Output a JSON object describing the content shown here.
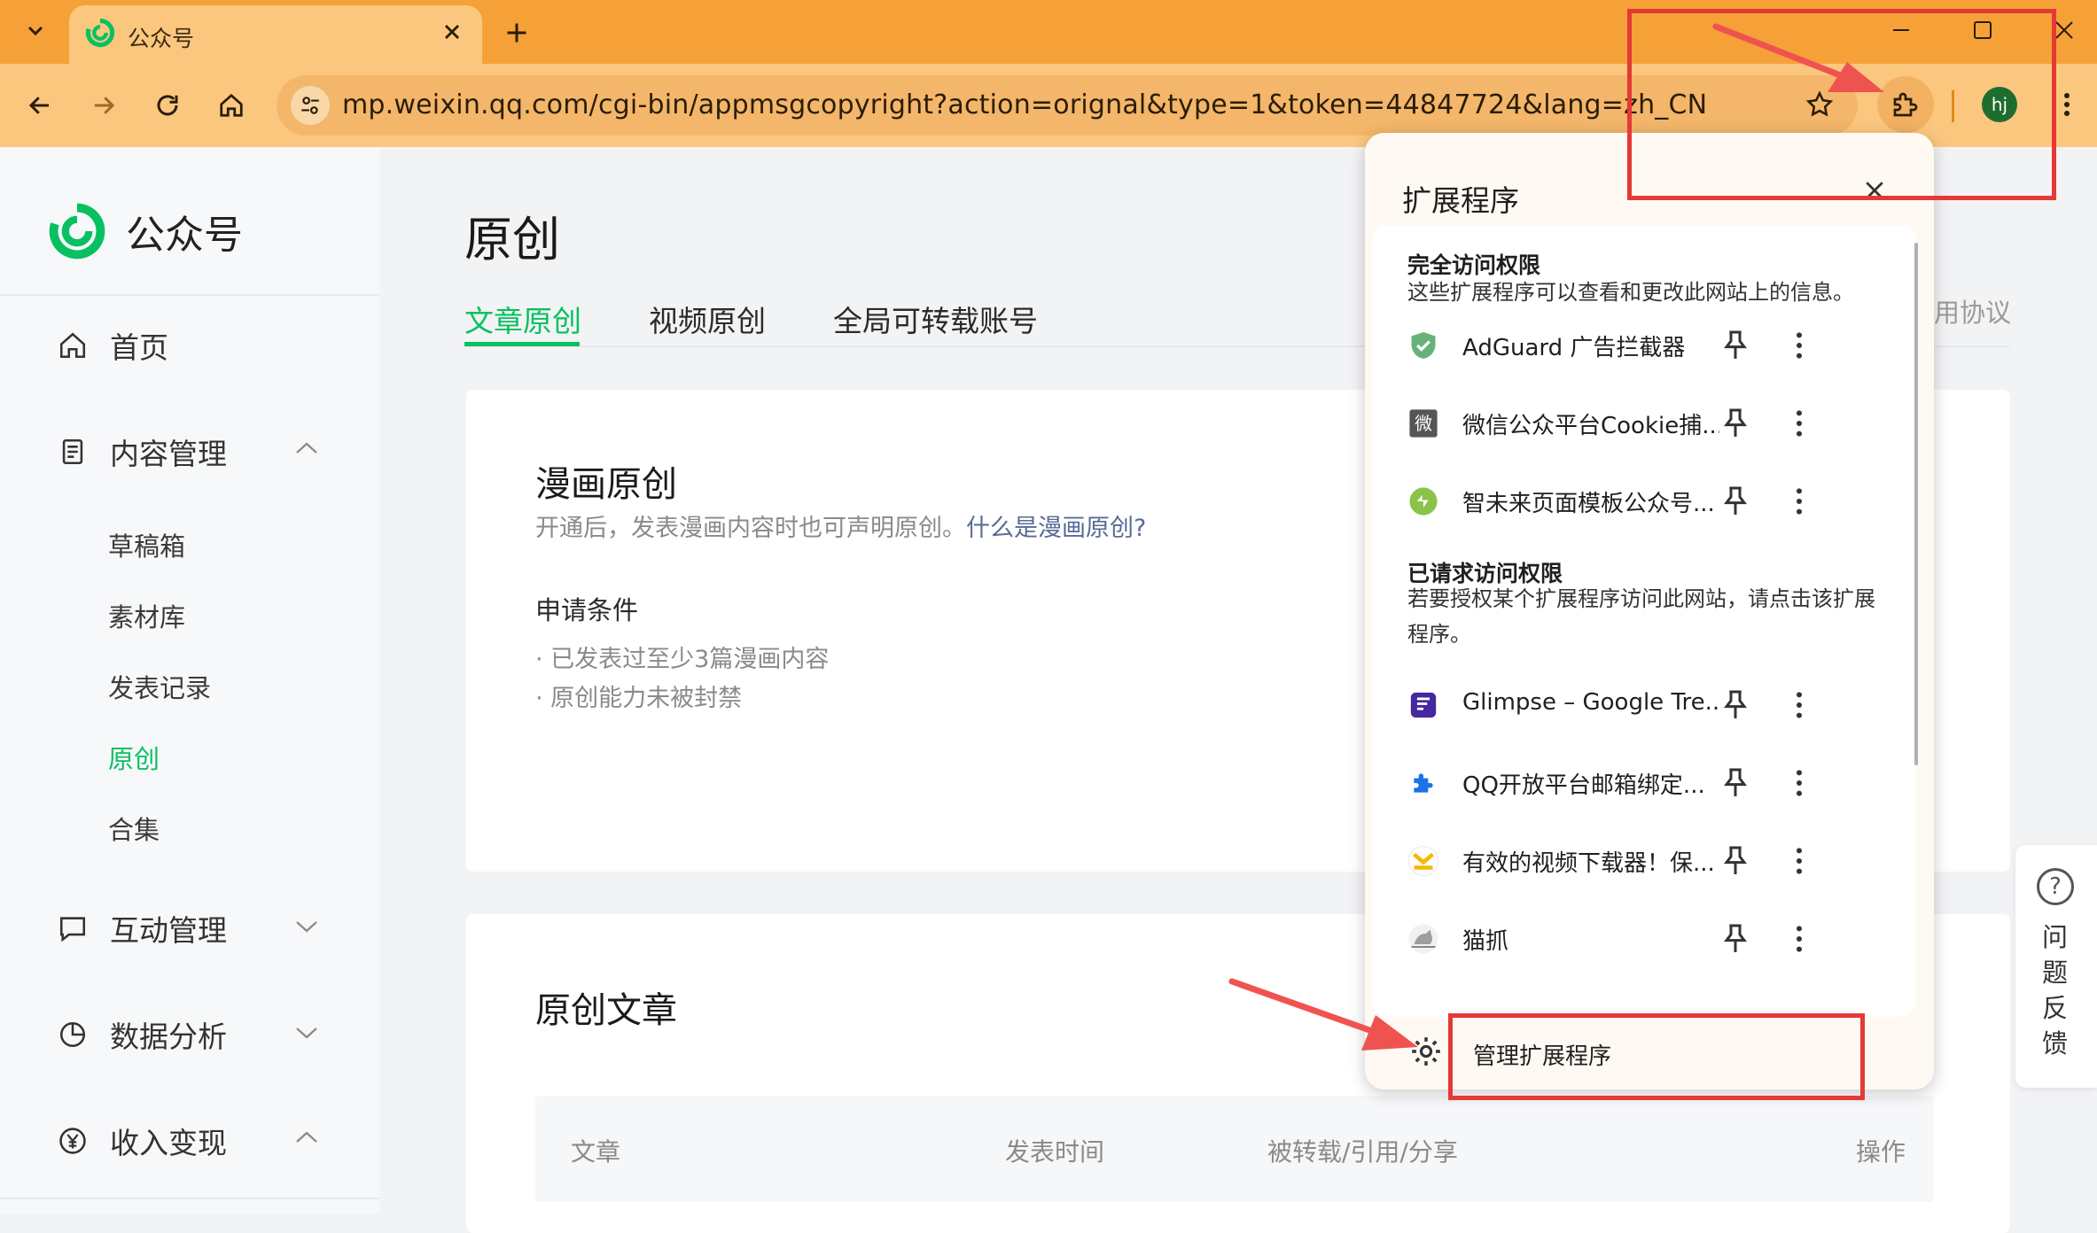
{
  "browser": {
    "tab_title": "公众号",
    "url": "mp.weixin.qq.com/cgi-bin/appmsgcopyright?action=orignal&type=1&token=44847724&lang=zh_CN",
    "profile_initials": "hj"
  },
  "sidebar": {
    "brand": "公众号",
    "items": [
      {
        "label": "首页",
        "icon": "home-icon"
      },
      {
        "label": "内容管理",
        "icon": "document-icon",
        "expanded": true
      },
      {
        "label": "互动管理",
        "icon": "chat-icon",
        "expanded": false
      },
      {
        "label": "数据分析",
        "icon": "pie-chart-icon",
        "expanded": false
      },
      {
        "label": "收入变现",
        "icon": "yen-icon",
        "expanded": true
      }
    ],
    "sub_items": [
      "草稿箱",
      "素材库",
      "发表记录",
      "原创",
      "合集"
    ],
    "active_sub_item": "原创"
  },
  "main": {
    "title": "原创",
    "tabs": [
      "文章原创",
      "视频原创",
      "全局可转载账号"
    ],
    "active_tab": "文章原创",
    "agreement_link": "用协议",
    "comic_card": {
      "title": "漫画原创",
      "desc": "开通后，发表漫画内容时也可声明原创。",
      "link": "什么是漫画原创?",
      "conditions_title": "申请条件",
      "conditions": [
        "· 已发表过至少3篇漫画内容",
        "· 原创能力未被封禁"
      ]
    },
    "article_card": {
      "title": "原创文章",
      "columns": [
        "文章",
        "发表时间",
        "被转载/引用/分享",
        "操作"
      ]
    }
  },
  "feedback": {
    "label": "问题反馈",
    "icon": "question-icon"
  },
  "extensions_popup": {
    "title": "扩展程序",
    "full_access": {
      "title": "完全访问权限",
      "desc": "这些扩展程序可以查看和更改此网站上的信息。",
      "items": [
        {
          "name": "AdGuard 广告拦截器",
          "icon": "adguard-shield-icon"
        },
        {
          "name": "微信公众平台Cookie捕...",
          "icon": "wei-logo-icon"
        },
        {
          "name": "智未来页面模板公众号...",
          "icon": "zhiweilai-logo-icon"
        }
      ]
    },
    "requested_access": {
      "title": "已请求访问权限",
      "desc": "若要授权某个扩展程序访问此网站，请点击该扩展程序。",
      "items": [
        {
          "name": "Glimpse – Google Tre...",
          "icon": "glimpse-logo-icon"
        },
        {
          "name": "QQ开放平台邮箱绑定...",
          "icon": "puzzle-piece-icon"
        },
        {
          "name": "有效的视频下载器！保...",
          "icon": "video-downloader-icon"
        },
        {
          "name": "猫抓",
          "icon": "cat-logo-icon"
        }
      ]
    },
    "manage_label": "管理扩展程序"
  },
  "colors": {
    "chrome_frame": "#f6a138",
    "toolbar": "#fbc77f",
    "wechat_green": "#07c160",
    "link_blue": "#576b95",
    "annotation_red": "#e53935"
  }
}
